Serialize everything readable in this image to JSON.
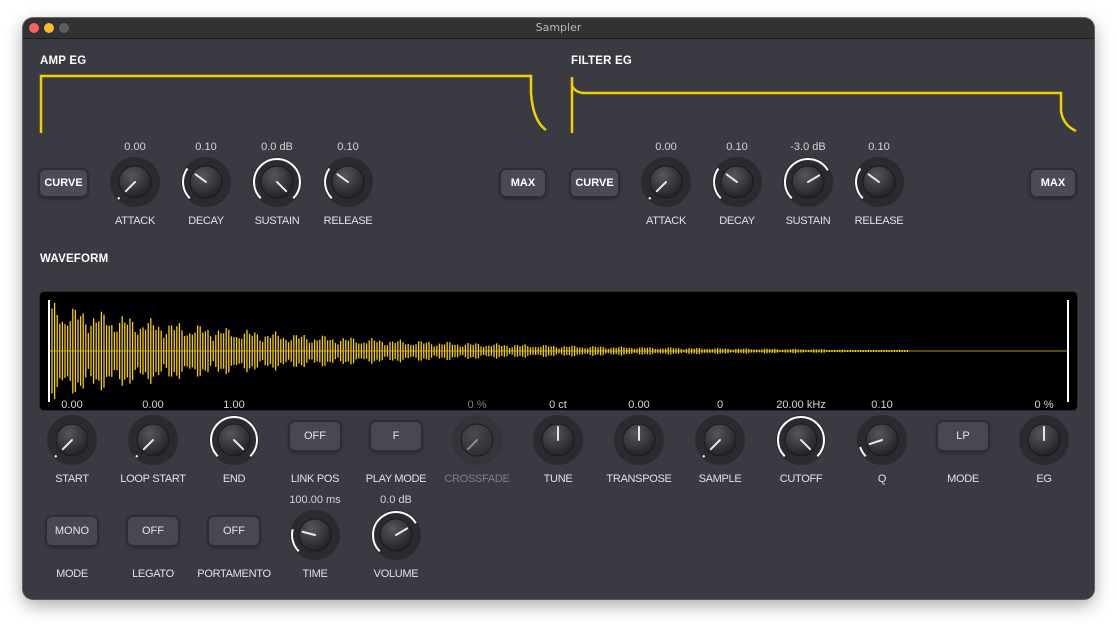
{
  "window": {
    "title": "Sampler",
    "traffic_lights": [
      "close",
      "minimize",
      "zoom"
    ]
  },
  "colors": {
    "accent": "#f5d000",
    "background": "#393a42",
    "knob_arc": "#ffffff",
    "waveform_bg": "#000000"
  },
  "amp_eg": {
    "title": "AMP EG",
    "curve_label": "CURVE",
    "max_label": "MAX",
    "knobs": [
      {
        "label": "ATTACK",
        "value": "0.00",
        "norm": 0.0
      },
      {
        "label": "DECAY",
        "value": "0.10",
        "norm": 0.3
      },
      {
        "label": "SUSTAIN",
        "value": "0.0 dB",
        "norm": 1.0
      },
      {
        "label": "RELEASE",
        "value": "0.10",
        "norm": 0.3
      }
    ]
  },
  "filter_eg": {
    "title": "FILTER EG",
    "curve_label": "CURVE",
    "max_label": "MAX",
    "knobs": [
      {
        "label": "ATTACK",
        "value": "0.00",
        "norm": 0.0
      },
      {
        "label": "DECAY",
        "value": "0.10",
        "norm": 0.3
      },
      {
        "label": "SUSTAIN",
        "value": "-3.0 dB",
        "norm": 0.72
      },
      {
        "label": "RELEASE",
        "value": "0.10",
        "norm": 0.3
      }
    ]
  },
  "waveform": {
    "title": "WAVEFORM",
    "start_marker": 0.0,
    "end_marker": 1.0
  },
  "sample_row": [
    {
      "type": "knob",
      "label": "START",
      "value": "0.00",
      "norm": 0.0,
      "arc": false
    },
    {
      "type": "knob",
      "label": "LOOP START",
      "value": "0.00",
      "norm": 0.0,
      "arc": false
    },
    {
      "type": "knob",
      "label": "END",
      "value": "1.00",
      "norm": 1.0,
      "arc": true
    },
    {
      "type": "button",
      "label": "LINK POS",
      "value": "OFF"
    },
    {
      "type": "button",
      "label": "PLAY MODE",
      "value": "F"
    },
    {
      "type": "knob",
      "label": "CROSSFADE",
      "value": "0 %",
      "norm": 0.0,
      "arc": false,
      "disabled": true
    },
    {
      "type": "knob",
      "label": "TUNE",
      "value": "0 ct",
      "norm": 0.5,
      "arc": false
    },
    {
      "type": "knob",
      "label": "TRANSPOSE",
      "value": "0.00",
      "norm": 0.5,
      "arc": false
    },
    {
      "type": "knob",
      "label": "SAMPLE",
      "value": "0",
      "norm": 0.0,
      "arc": false
    },
    {
      "type": "knob",
      "label": "CUTOFF",
      "value": "20.00 kHz",
      "norm": 1.0,
      "arc": true
    },
    {
      "type": "knob",
      "label": "Q",
      "value": "0.10",
      "norm": 0.1,
      "arc": true
    },
    {
      "type": "button",
      "label": "MODE",
      "value": "LP"
    },
    {
      "type": "knob",
      "label": "EG",
      "value": "0 %",
      "norm": 0.5,
      "arc": false
    }
  ],
  "voice_row": [
    {
      "type": "button",
      "label": "MODE",
      "value": "MONO"
    },
    {
      "type": "button",
      "label": "LEGATO",
      "value": "OFF"
    },
    {
      "type": "button",
      "label": "PORTAMENTO",
      "value": "OFF"
    },
    {
      "type": "knob",
      "label": "TIME",
      "value": "100.00 ms",
      "norm": 0.22,
      "arc": true
    },
    {
      "type": "knob",
      "label": "VOLUME",
      "value": "0.0 dB",
      "norm": 0.72,
      "arc": true
    }
  ]
}
